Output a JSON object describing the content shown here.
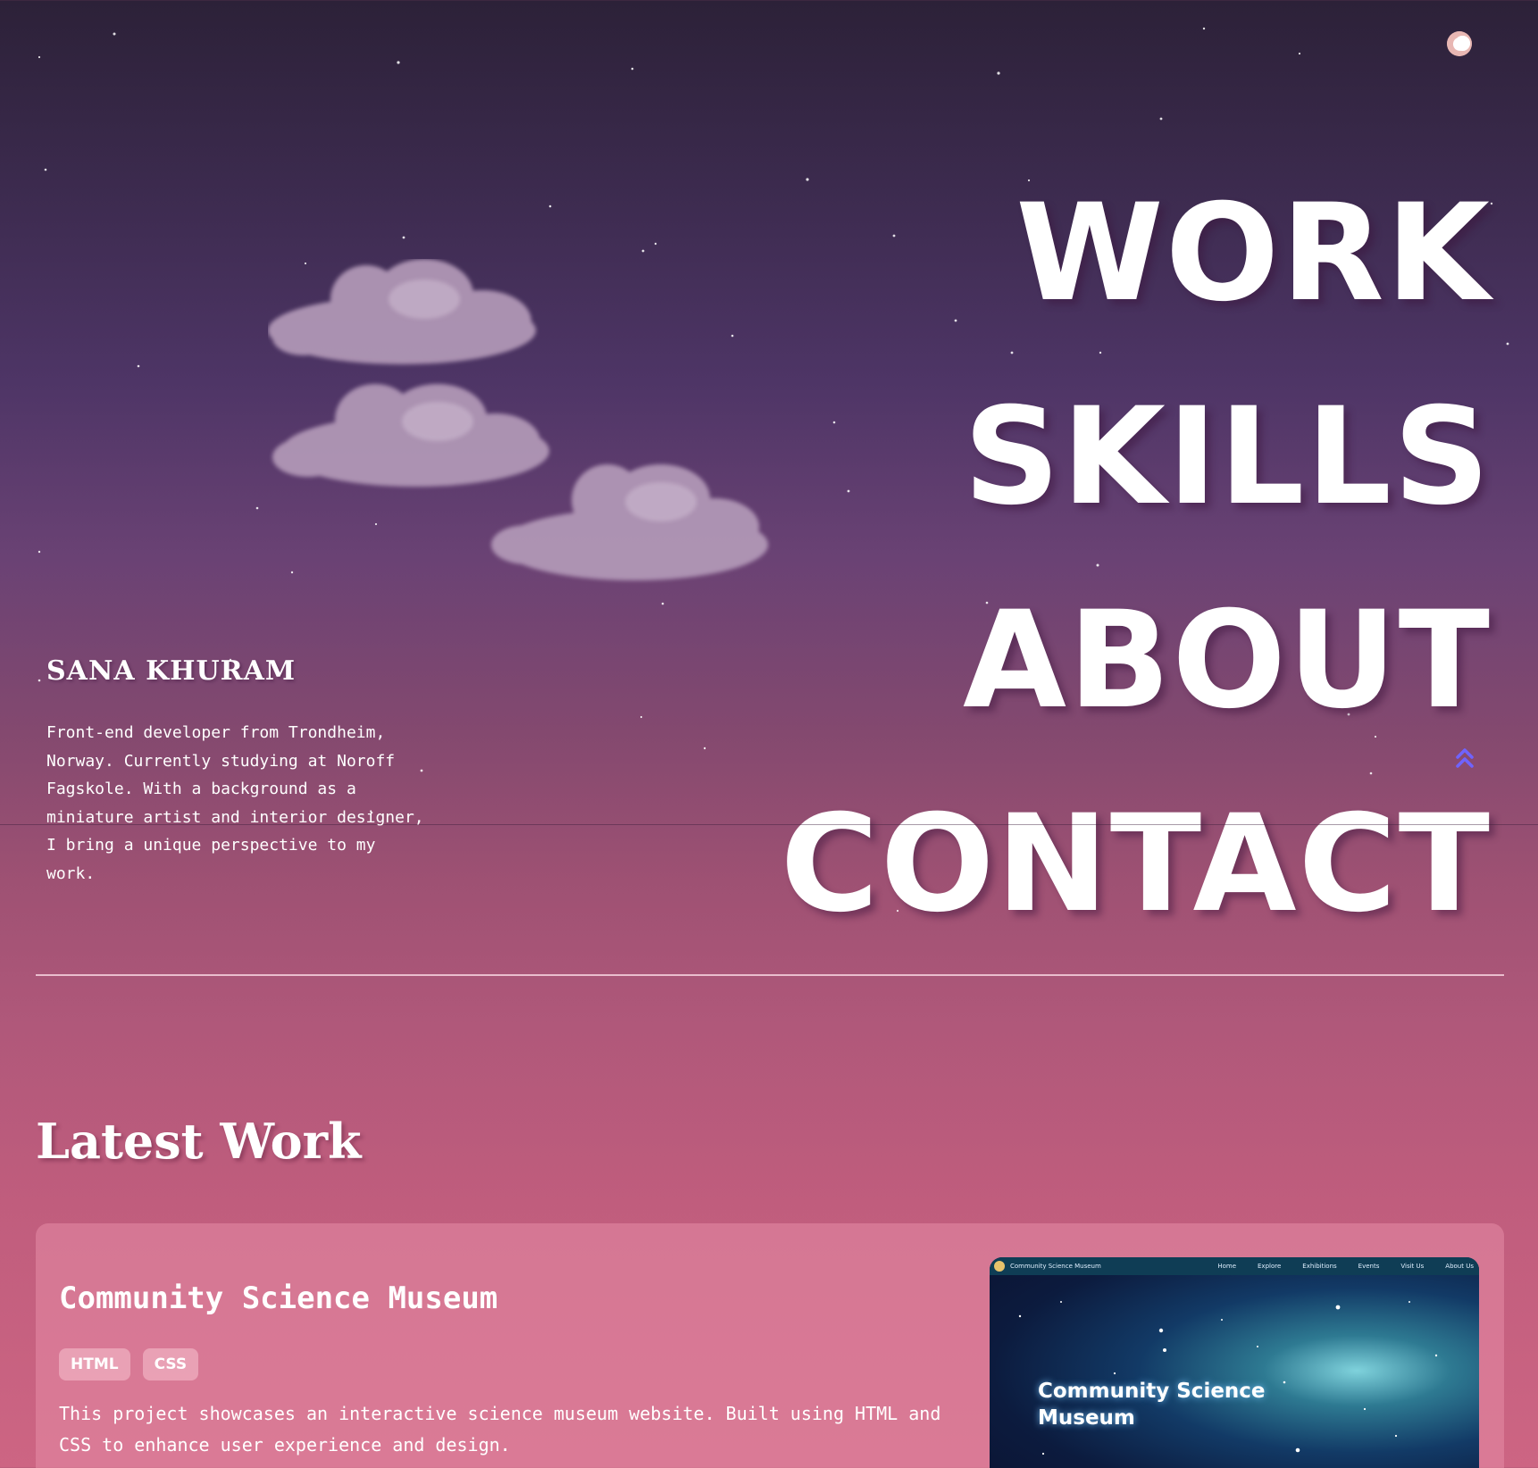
{
  "colors": {
    "background_top": "#2c2138",
    "background_mid": "#84496f",
    "background_bottom": "#cd6583",
    "text": "#ffffff",
    "accent_icon": "#6f63ff",
    "moon_button": "#e8b7b3"
  },
  "header": {
    "theme_toggle_icon": "moon-icon"
  },
  "nav": {
    "items": [
      {
        "label": "WORK"
      },
      {
        "label": "SKILLS"
      },
      {
        "label": "ABOUT"
      },
      {
        "label": "CONTACT"
      }
    ]
  },
  "intro": {
    "name": "SANA KHURAM",
    "bio": "Front-end developer from Trondheim, Norway. Currently studying at Noroff Fagskole. With a background as a miniature artist and interior designer, I bring a unique perspective to my work."
  },
  "scroll_up_icon": "double-chevron-up-icon",
  "latest_work": {
    "title": "Latest Work",
    "projects": [
      {
        "title": "Community Science Museum",
        "tags": [
          "HTML",
          "CSS"
        ],
        "description": "This project showcases an interactive science museum website. Built using HTML and CSS to enhance user experience and design.",
        "thumbnail": {
          "brand": "Community Science Museum",
          "nav": [
            "Home",
            "Explore",
            "Exhibitions",
            "Events",
            "Visit Us",
            "About Us"
          ],
          "hero_line1": "Community Science",
          "hero_line2": "Museum"
        }
      }
    ]
  }
}
